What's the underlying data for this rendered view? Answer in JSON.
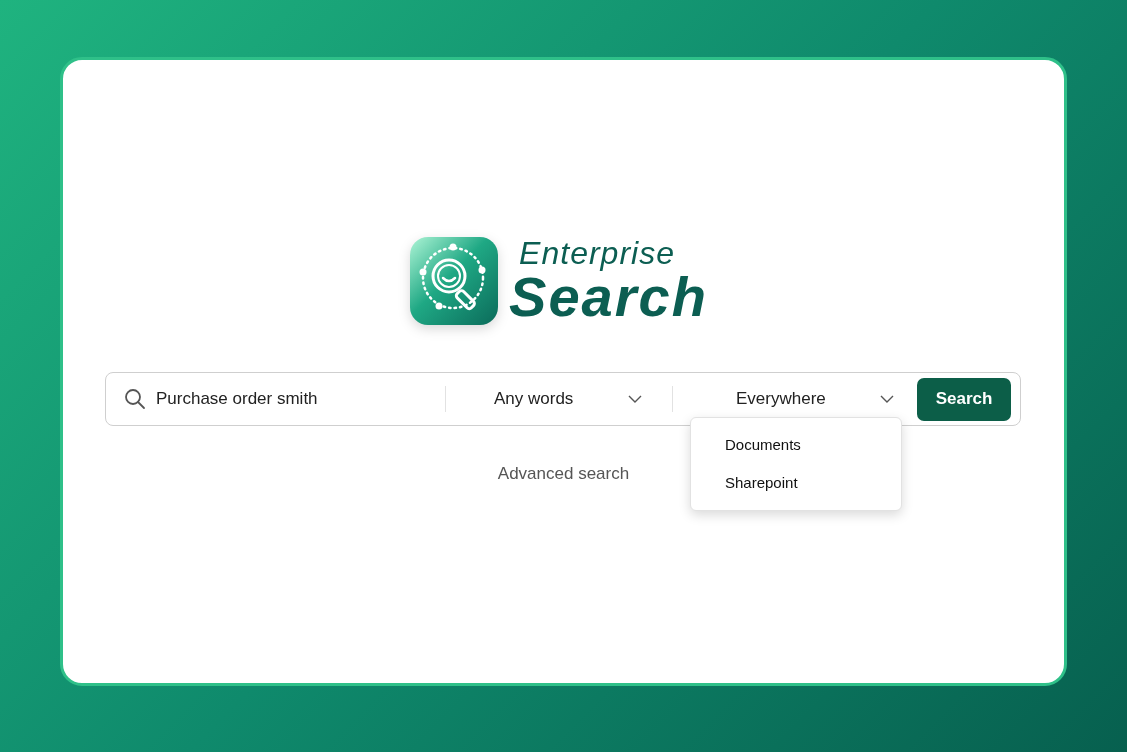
{
  "logo": {
    "line1": "Enterprise",
    "line2": "Search"
  },
  "search_bar": {
    "query": "Purchase order smith",
    "match_mode": {
      "value": "Any words"
    },
    "scope": {
      "value": "Everywhere",
      "expanded": true,
      "options": [
        {
          "label": "Documents"
        },
        {
          "label": "Sharepoint"
        }
      ]
    },
    "button": "Search"
  },
  "advanced_link": "Advanced search"
}
